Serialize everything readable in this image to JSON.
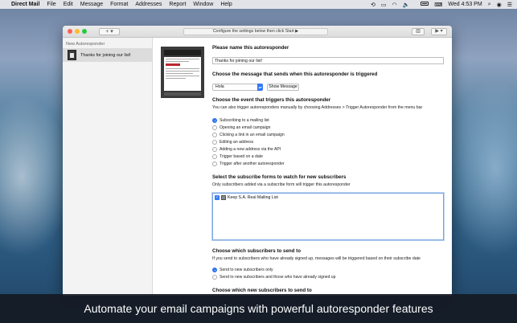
{
  "menubar": {
    "app_name": "Direct Mail",
    "items": [
      "File",
      "Edit",
      "Message",
      "Format",
      "Addresses",
      "Report",
      "Window",
      "Help"
    ],
    "clock": "Wed 4:53 PM",
    "status_icons": [
      "time-machine-icon",
      "screen-icon",
      "wifi-icon",
      "volume-icon",
      "battery-icon",
      "keyboard-icon",
      "search-icon",
      "user-icon",
      "menu-icon"
    ]
  },
  "toolbar": {
    "add_label": "+ ▾",
    "status_text": "Configure the settings below then click Start ▶",
    "chart_label": "▥",
    "start_label": "▶ ▾"
  },
  "sidebar": {
    "group_label": "New Autoresponder",
    "items": [
      {
        "label": "Thanks for joining our list!"
      }
    ]
  },
  "form": {
    "name_heading": "Please name this autoresponder",
    "name_value": "Thanks for joining our list!",
    "message_heading": "Choose the message that sends when this autoresponder is triggered",
    "message_value": "Hola",
    "show_message_label": "Show Message",
    "event_heading": "Choose the event that triggers this autoresponder",
    "event_sub": "You can also trigger autoresponders manually by choosing Addresses > Trigger Autoresponder from the menu bar",
    "events": [
      {
        "label": "Subscribing to a mailing list",
        "selected": true
      },
      {
        "label": "Opening an email campaign",
        "selected": false
      },
      {
        "label": "Clicking a link in an email campaign",
        "selected": false
      },
      {
        "label": "Editing an address",
        "selected": false
      },
      {
        "label": "Adding a new address via the API",
        "selected": false
      },
      {
        "label": "Trigger based on a date",
        "selected": false
      },
      {
        "label": "Trigger after another autoresponder",
        "selected": false
      }
    ],
    "forms_heading": "Select the subscribe forms to watch for new subscribers",
    "forms_sub": "Only subscribers added via a subscribe form will trigger this autoresponder",
    "forms_list": [
      {
        "label": "Keep S.A. Real Mailing List",
        "checked": true
      }
    ],
    "send_heading": "Choose which subscribers to send to",
    "send_sub": "If you send to subscribers who have already signed up, messages will be triggered based on their subscribe date",
    "send_options": [
      {
        "label": "Send to new subscribers only",
        "selected": true
      },
      {
        "label": "Send to new subscribers and those who have already signed up",
        "selected": false
      }
    ],
    "next_heading": "Choose which new subscribers to send to"
  },
  "caption": "Automate your email campaigns with powerful autoresponder features"
}
